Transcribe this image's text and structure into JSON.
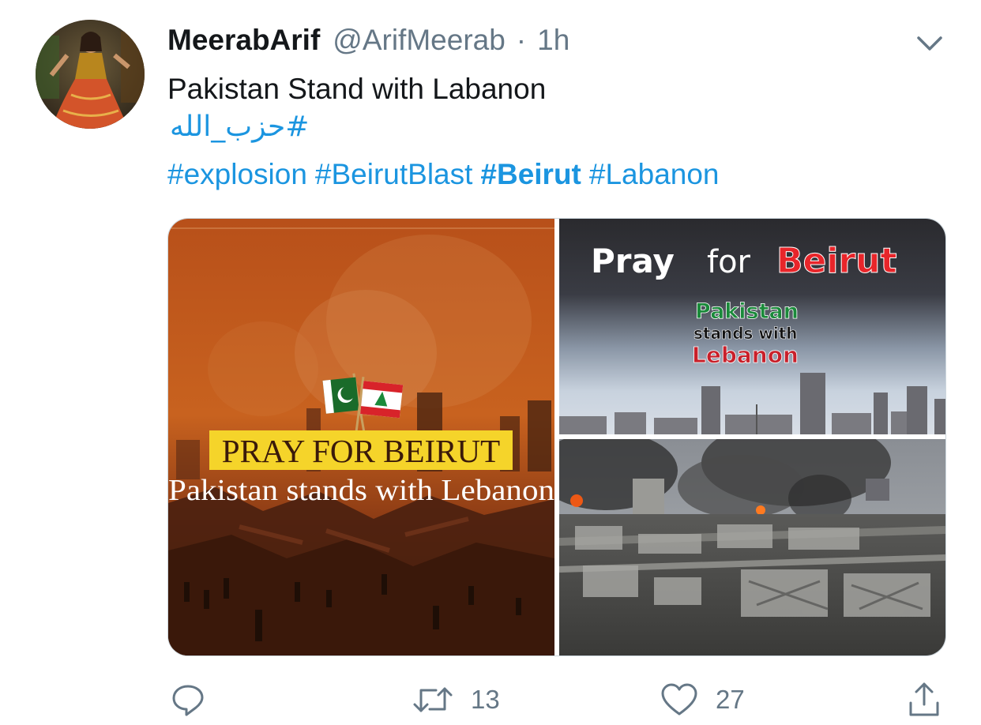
{
  "tweet": {
    "display_name": "MeerabArif",
    "handle": "@ArifMeerab",
    "separator": "·",
    "time": "1h",
    "text": "Pakistan Stand with Labanon",
    "urdu_hashtag": "#حزب_الله",
    "hashtags": [
      {
        "text": "#explosion",
        "bold": false
      },
      {
        "text": "#BeirutBlast",
        "bold": false
      },
      {
        "text": "#Beirut",
        "bold": true
      },
      {
        "text": "#Labanon",
        "bold": false
      }
    ]
  },
  "media": {
    "image1": {
      "banner": "PRAY FOR BEIRUT",
      "subtitle": "Pakistan stands with Lebanon"
    },
    "image2": {
      "pray": "Pray",
      "for": "for",
      "beirut": "Beirut",
      "line1": "Pakistan",
      "line2": "stands with",
      "line3": "Lebanon"
    },
    "image3": {}
  },
  "actions": {
    "reply_count": "",
    "retweet_count": "13",
    "like_count": "27"
  },
  "colors": {
    "link": "#1b95e0",
    "secondary": "#657786",
    "text": "#14171a"
  }
}
